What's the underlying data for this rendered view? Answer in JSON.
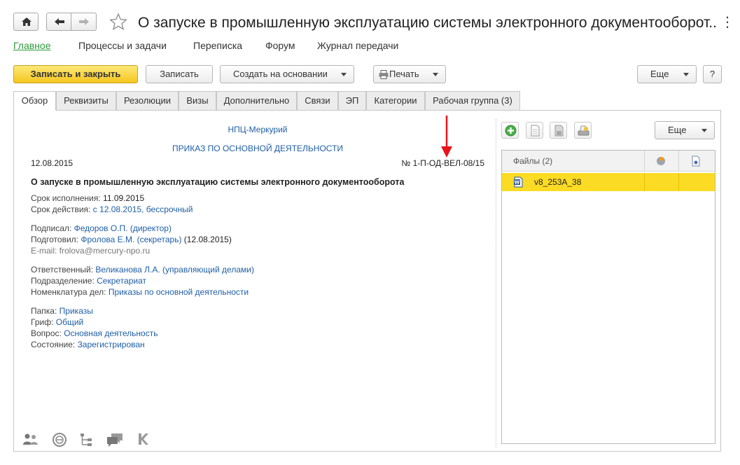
{
  "window": {
    "title": "О запуске в промышленную эксплуатацию системы электронного документооборот...",
    "more_glyph": "⋮"
  },
  "sections": [
    {
      "label": "Главное",
      "active": true
    },
    {
      "label": "Процессы и задачи"
    },
    {
      "label": "Переписка"
    },
    {
      "label": "Форум"
    },
    {
      "label": "Журнал передачи"
    }
  ],
  "toolbar": {
    "save_close": "Записать и закрыть",
    "save": "Записать",
    "create_based": "Создать на основании",
    "print": "Печать",
    "more": "Еще",
    "help": "?"
  },
  "tabs": [
    {
      "label": "Обзор",
      "active": true
    },
    {
      "label": "Реквизиты"
    },
    {
      "label": "Резолюции"
    },
    {
      "label": "Визы"
    },
    {
      "label": "Дополнительно"
    },
    {
      "label": "Связи"
    },
    {
      "label": "ЭП"
    },
    {
      "label": "Категории"
    },
    {
      "label": "Рабочая группа (3)"
    }
  ],
  "doc": {
    "org": "НПЦ-Меркурий",
    "doc_type": "ПРИКАЗ ПО ОСНОВНОЙ ДЕЯТЕЛЬНОСТИ",
    "date": "12.08.2015",
    "number": "№ 1-П-ОД-ВЕЛ-08/15",
    "heading": "О запуске в промышленную эксплуатацию системы электронного документооборота",
    "deadline_label": "Срок исполнения:",
    "deadline_value": "11.09.2015",
    "validity_label": "Срок действия:",
    "validity_value": "с 12.08.2015, бессрочный",
    "signed_label": "Подписал:",
    "signed_value": "Федоров О.П. (директор)",
    "prepared_label": "Подготовил:",
    "prepared_value": "Фролова Е.М. (секретарь)",
    "prepared_date": "(12.08.2015)",
    "email": "E-mail: frolova@mercury-npo.ru",
    "responsible_label": "Ответственный:",
    "responsible_value": "Великанова Л.А. (управляющий делами)",
    "department_label": "Подразделение:",
    "department_value": "Секретариат",
    "nomenclature_label": "Номенклатура дел:",
    "nomenclature_value": "Приказы по основной деятельности",
    "folder_label": "Папка:",
    "folder_value": "Приказы",
    "stamp_label": "Гриф:",
    "stamp_value": "Общий",
    "question_label": "Вопрос:",
    "question_value": "Основная деятельность",
    "status_label": "Состояние:",
    "status_value": "Зарегистрирован"
  },
  "files_panel": {
    "more": "Еще",
    "header": "Файлы (2)",
    "rows": [
      {
        "name": "v8_253A_38",
        "icon": "word-doc-icon"
      }
    ]
  },
  "bottom_icons": [
    "users-icon",
    "discussion-icon",
    "tree-icon",
    "chat-icon",
    "letter-k-icon"
  ],
  "colors": {
    "accent_green": "#2d9c3c",
    "primary_button": "#f5c61f",
    "link_blue": "#1f5fa6",
    "selected_row": "#fbdb24",
    "annotation_arrow": "#e8131b"
  }
}
